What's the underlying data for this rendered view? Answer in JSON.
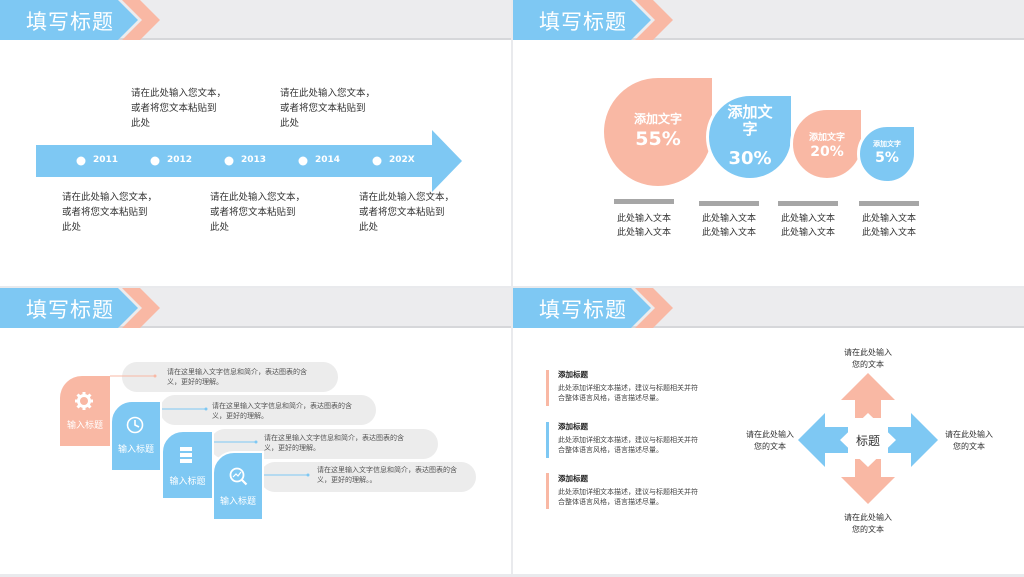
{
  "colors": {
    "blue": "#7ec8f3",
    "salmon": "#f9b8a4",
    "header_bg": "#ececee",
    "text": "#333333"
  },
  "slide1": {
    "title": "填写标题",
    "years": [
      "2011",
      "2012",
      "2013",
      "2014",
      "202X"
    ],
    "top_texts": [
      "请在此处输入您文本，\n或者将您文本粘贴到\n此处",
      "请在此处输入您文本，\n或者将您文本粘贴到\n此处"
    ],
    "bottom_texts": [
      "请在此处输入您文本，\n或者将您文本粘贴到\n此处",
      "请在此处输入您文本，\n或者将您文本粘贴到\n此处",
      "请在此处输入您文本，\n或者将您文本粘贴到\n此处"
    ]
  },
  "slide2": {
    "title": "填写标题",
    "drops": [
      {
        "label": "添加文字",
        "value": "55%",
        "color": "salmon"
      },
      {
        "label": "添加文\n字",
        "value": "30%",
        "color": "blue"
      },
      {
        "label": "添加文字",
        "value": "20%",
        "color": "salmon"
      },
      {
        "label": "添加文字",
        "value": "5%",
        "color": "blue"
      }
    ],
    "captions": [
      "此处输入文本\n此处输入文本",
      "此处输入文本\n此处输入文本",
      "此处输入文本\n此处输入文本",
      "此处输入文本\n此处输入文本"
    ]
  },
  "slide3": {
    "title": "填写标题",
    "steps": [
      {
        "label": "输入标题",
        "icon": "gear-icon",
        "color": "salmon",
        "desc": "请在这里输入文字信息和简介，表达图表的含\n义，更好的理解。"
      },
      {
        "label": "输入标题",
        "icon": "clock-icon",
        "color": "blue",
        "desc": "请在这里输入文字信息和简介，表达图表的含\n义，更好的理解。"
      },
      {
        "label": "输入标题",
        "icon": "server-icon",
        "color": "blue",
        "desc": "请在这里输入文字信息和简介，表达图表的含\n义，更好的理解。"
      },
      {
        "label": "输入标题",
        "icon": "search-chart-icon",
        "color": "blue",
        "desc": "请在这里输入文字信息和简介，表达图表的含\n义，更好的理解。。"
      }
    ]
  },
  "slide4": {
    "title": "填写标题",
    "items": [
      {
        "heading": "添加标题",
        "body": "此处添加详细文本描述，建议与标题相关并符\n合整体语言风格，语言描述尽量。",
        "color": "salmon"
      },
      {
        "heading": "添加标题",
        "body": "此处添加详细文本描述，建议与标题相关并符\n合整体语言风格，语言描述尽量。",
        "color": "blue"
      },
      {
        "heading": "添加标题",
        "body": "此处添加详细文本描述，建议与标题相关并符\n合整体语言风格，语言描述尽量。",
        "color": "salmon"
      }
    ],
    "center": "标题",
    "top": "请在此处输入\n您的文本",
    "left": "请在此处输入\n您的文本",
    "right": "请在此处输入\n您的文本",
    "bottom": "请在此处输入\n您的文本"
  }
}
